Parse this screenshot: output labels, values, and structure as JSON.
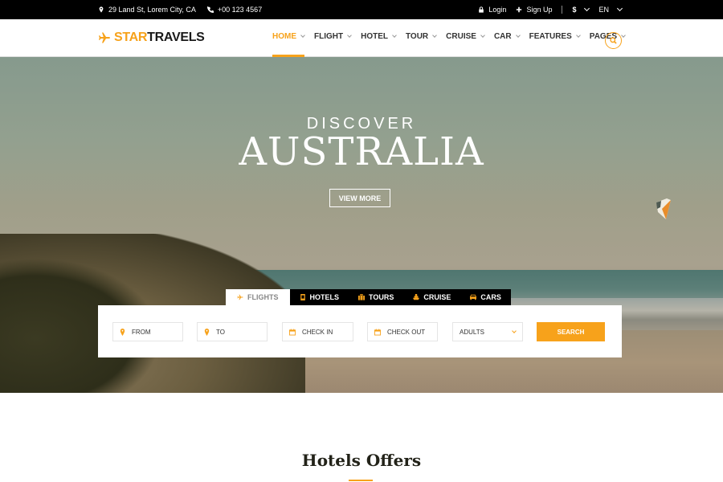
{
  "topbar": {
    "address": "29 Land St, Lorem City, CA",
    "phone": "+00 123 4567",
    "login": "Login",
    "signup": "Sign Up",
    "currency": "$",
    "language": "EN"
  },
  "header": {
    "logo_part1": "STAR",
    "logo_part2": "TRAVELS",
    "nav": [
      {
        "label": "HOME",
        "active": true
      },
      {
        "label": "FLIGHT"
      },
      {
        "label": "HOTEL"
      },
      {
        "label": "TOUR"
      },
      {
        "label": "CRUISE"
      },
      {
        "label": "CAR"
      },
      {
        "label": "FEATURES"
      },
      {
        "label": "PAGES"
      }
    ],
    "search_icon": "search-icon"
  },
  "hero": {
    "subtitle": "DISCOVER",
    "title": "AUSTRALIA",
    "button": "VIEW MORE"
  },
  "booking": {
    "tabs": [
      {
        "label": "FLIGHTS",
        "icon": "plane-icon",
        "active": true
      },
      {
        "label": "HOTELS",
        "icon": "hotel-icon"
      },
      {
        "label": "TOURS",
        "icon": "suitcase-icon"
      },
      {
        "label": "CRUISE",
        "icon": "ship-icon"
      },
      {
        "label": "CARS",
        "icon": "car-icon"
      }
    ],
    "fields": {
      "from": "FROM",
      "to": "TO",
      "check_in": "CHECK IN",
      "check_out": "CHECK OUT",
      "adults": "ADULTS"
    },
    "search_button": "SEARCH"
  },
  "offers": {
    "title": "Hotels Offers"
  },
  "colors": {
    "accent": "#f7a21b",
    "topbar": "#000000"
  }
}
